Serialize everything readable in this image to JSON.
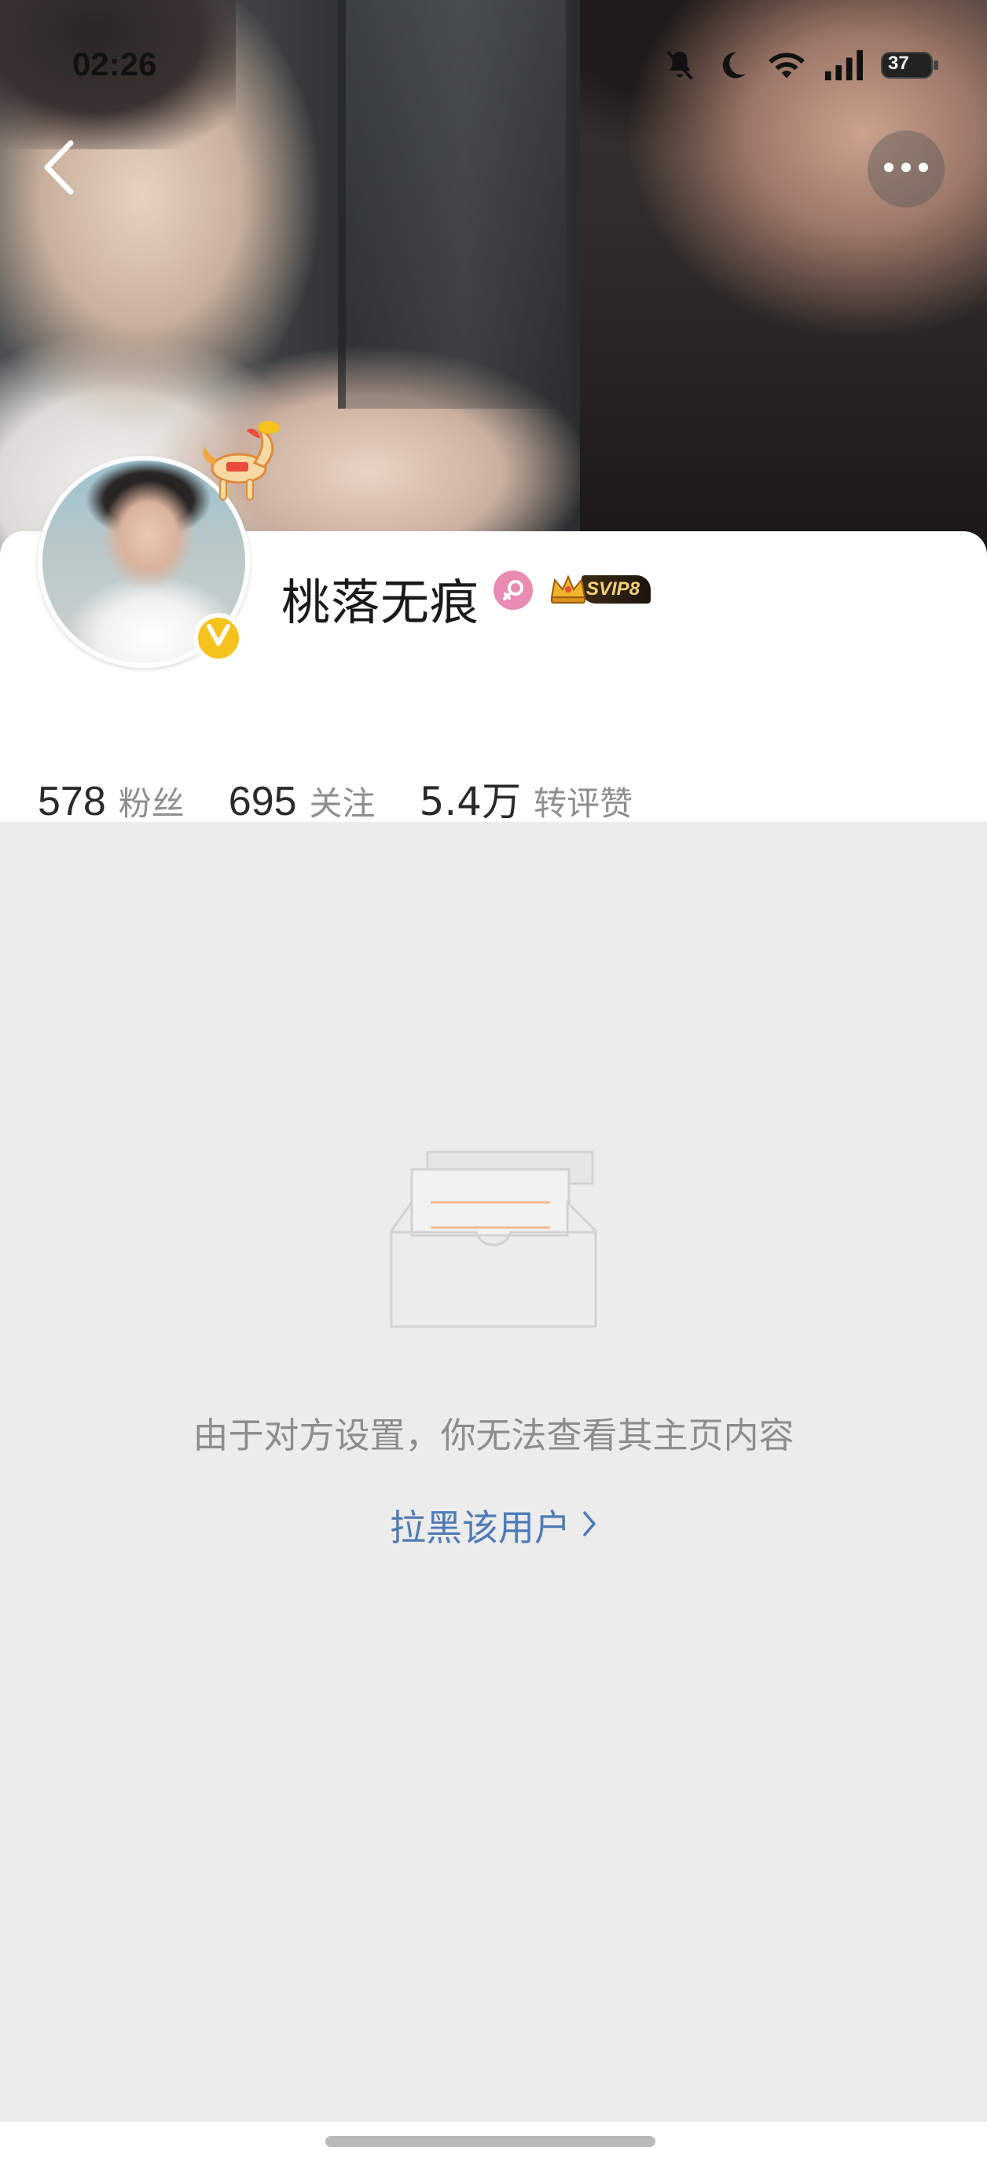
{
  "status_bar": {
    "time": "02:26",
    "battery": "37",
    "icons": [
      "bell-muted-icon",
      "moon-icon",
      "wifi-icon",
      "signal-icon",
      "battery-icon"
    ]
  },
  "nav": {
    "back_icon": "chevron-left-icon",
    "more_icon": "more-dots-icon"
  },
  "profile": {
    "nickname": "桃落无痕",
    "gender": "female",
    "vip_badge": "SVIP8",
    "verified": true
  },
  "stats": [
    {
      "value": "578",
      "label": "粉丝"
    },
    {
      "value": "695",
      "label": "关注"
    },
    {
      "value": "5.4万",
      "label": "转评赞"
    }
  ],
  "empty_state": {
    "message": "由于对方设置，你无法查看其主页内容",
    "block_link": "拉黑该用户"
  },
  "colors": {
    "background": "#ececec",
    "link": "#4f7bb5",
    "verified": "#f6c21c",
    "gender": "#e98bb2",
    "svip_gold": "#f6cf78"
  }
}
